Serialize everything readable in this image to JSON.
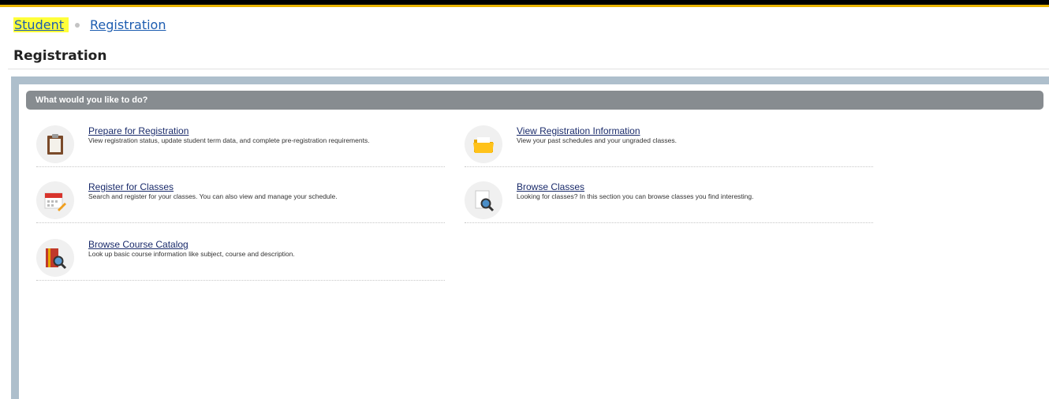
{
  "breadcrumb": {
    "items": [
      "Student",
      "Registration"
    ]
  },
  "page": {
    "title": "Registration"
  },
  "section": {
    "header": "What would you like to do?"
  },
  "actions": [
    {
      "title": "Prepare for Registration",
      "description": "View registration status, update student term data, and complete pre-registration requirements.",
      "icon": "clipboard-icon"
    },
    {
      "title": "View Registration Information",
      "description": "View your past schedules and your ungraded classes.",
      "icon": "folder-icon"
    },
    {
      "title": "Register for Classes",
      "description": "Search and register for your classes. You can also view and manage your schedule.",
      "icon": "calendar-pencil-icon"
    },
    {
      "title": "Browse Classes",
      "description": "Looking for classes? In this section you can browse classes you find interesting.",
      "icon": "document-search-icon"
    },
    {
      "title": "Browse Course Catalog",
      "description": "Look up basic course information like subject, course and description.",
      "icon": "book-search-icon"
    }
  ],
  "colors": {
    "accent": "#e8b400",
    "link": "#1c5cb0",
    "highlight": "#ffff3a",
    "header_bg": "#878c90",
    "frame": "#aebfcc"
  }
}
